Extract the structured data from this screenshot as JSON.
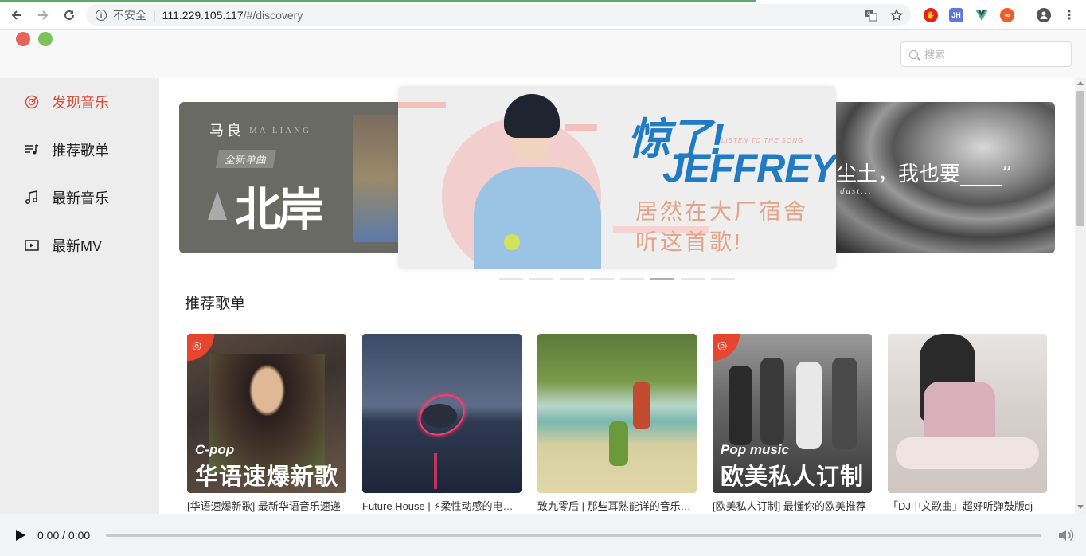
{
  "browser": {
    "security_label": "不安全",
    "url_host": "111.229.105.117",
    "url_path": "/#/discovery"
  },
  "search": {
    "placeholder": "搜索"
  },
  "sidebar": {
    "items": [
      {
        "label": "发现音乐",
        "icon": "target-icon",
        "active": true
      },
      {
        "label": "推荐歌单",
        "icon": "playlist-icon",
        "active": false
      },
      {
        "label": "最新音乐",
        "icon": "music-note-icon",
        "active": false
      },
      {
        "label": "最新MV",
        "icon": "video-icon",
        "active": false
      }
    ]
  },
  "carousel": {
    "left": {
      "artist": "马良",
      "artist_en": "MA LIANG",
      "tag": "全新单曲",
      "song": "北岸"
    },
    "center": {
      "title": "惊了!",
      "name": "JEFFREY",
      "listen": "LISTEN TO THE SONG",
      "line1": "居然在大厂宿舍",
      "line2": "听这首歌!"
    },
    "right": {
      "text": "尘土，我也要____”",
      "sub": "dust..."
    },
    "active_dot": 5,
    "dot_count": 8
  },
  "section": {
    "title": "推荐歌单"
  },
  "playlists": [
    {
      "title": "[华语速爆新歌] 最新华语音乐速递",
      "cover_en": "C-pop",
      "cover_cn": "华语速爆新歌",
      "badge": true
    },
    {
      "title": "Future House | ⚡柔性动感的电子音乐",
      "cover_en": "",
      "cover_cn": "",
      "badge": false
    },
    {
      "title": "致九零后 | 那些耳熟能详的音乐回忆",
      "cover_en": "",
      "cover_cn": "",
      "badge": false
    },
    {
      "title": "[欧美私人订制] 最懂你的欧美推荐",
      "cover_en": "Pop music",
      "cover_cn": "欧美私人订制",
      "badge": true
    },
    {
      "title": "「DJ中文歌曲」超好听弹鼓版dj",
      "cover_en": "",
      "cover_cn": "",
      "badge": false
    }
  ],
  "player": {
    "time": "0:00 / 0:00",
    "progress": 0
  },
  "colors": {
    "accent": "#d94f3d",
    "badge": "#e8452e",
    "jeffrey_blue": "#1e7bc4"
  }
}
